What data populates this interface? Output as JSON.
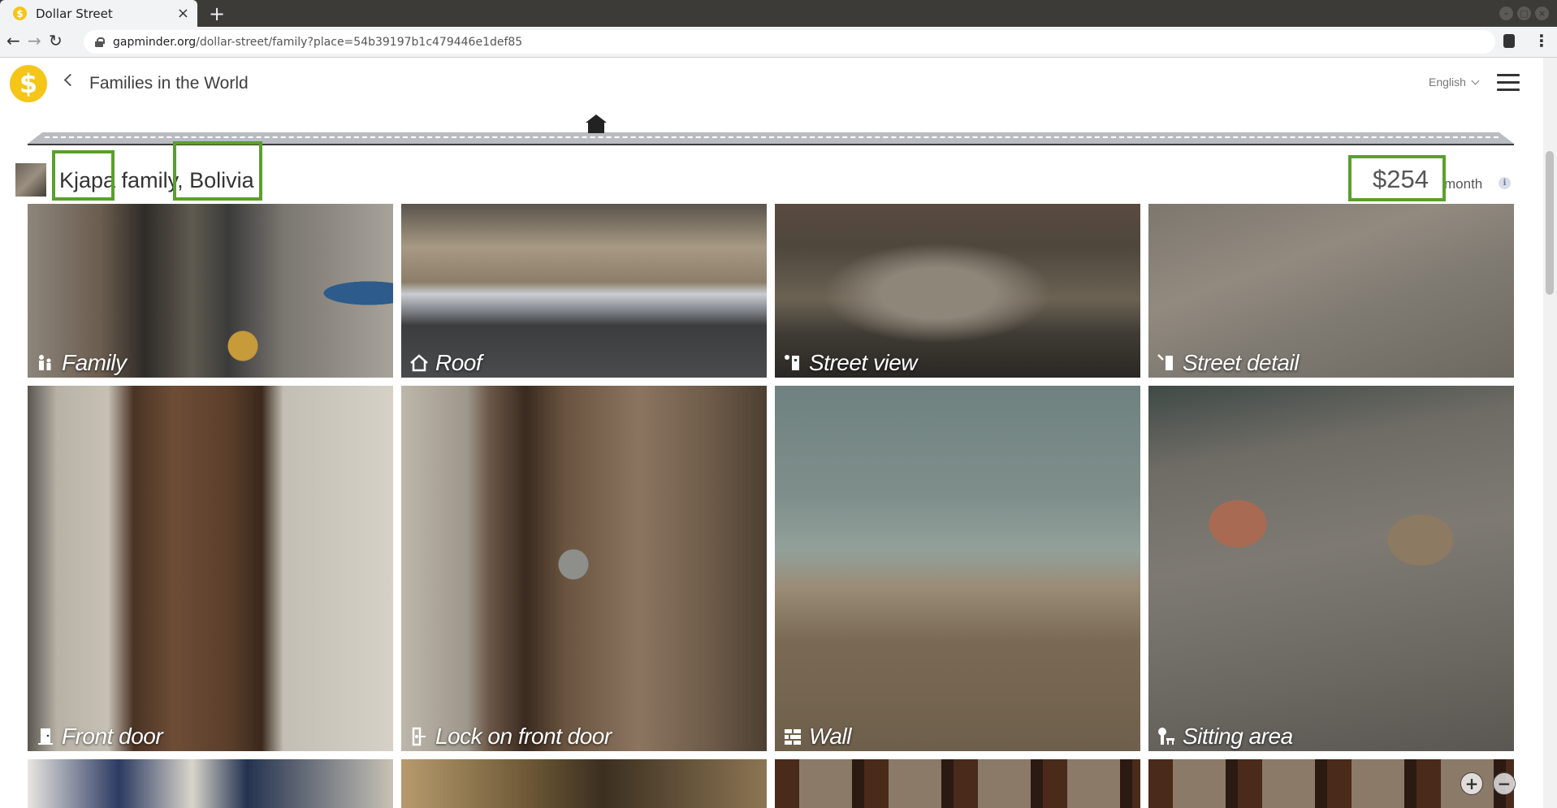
{
  "browser": {
    "tab_title": "Dollar Street",
    "tab_close": "×",
    "new_tab": "+",
    "url_host": "gapminder.org",
    "url_path": "/dollar-street/family?place=54b39197b1c479446e1def85"
  },
  "header": {
    "logo_symbol": "$",
    "title": "Families in the World",
    "language": "English"
  },
  "family": {
    "name": "Kjapa family",
    "country": ", Bolivia",
    "income": "$254",
    "income_period": "month",
    "info_symbol": "i"
  },
  "tiles": [
    {
      "label": "Family",
      "icon": "family-icon"
    },
    {
      "label": "Roof",
      "icon": "roof-icon"
    },
    {
      "label": "Street view",
      "icon": "street-view-icon"
    },
    {
      "label": "Street detail",
      "icon": "street-detail-icon"
    },
    {
      "label": "Front door",
      "icon": "front-door-icon"
    },
    {
      "label": "Lock on front door",
      "icon": "lock-icon"
    },
    {
      "label": "Wall",
      "icon": "wall-icon"
    },
    {
      "label": "Sitting area",
      "icon": "sitting-area-icon"
    }
  ],
  "zoom": {
    "in": "+",
    "out": "−"
  },
  "colors": {
    "highlight": "#5aa02c",
    "logo": "#f5c518"
  }
}
